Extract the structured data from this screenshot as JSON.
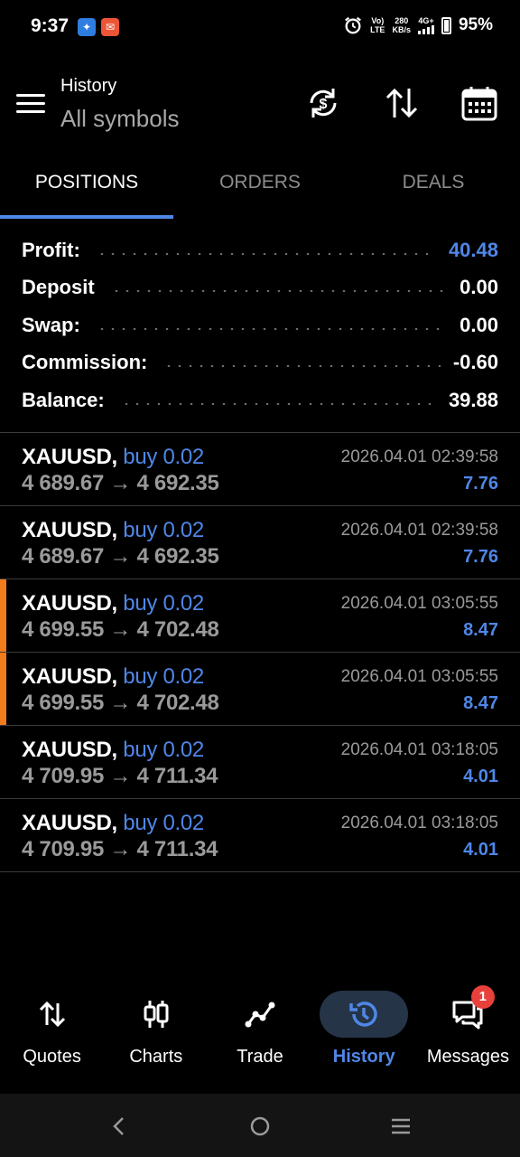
{
  "status_bar": {
    "time": "9:37",
    "network_top": "Vo)",
    "network_bottom": "LTE",
    "speed_value": "280",
    "speed_unit": "KB/s",
    "cell_label": "4G+",
    "battery": "95%"
  },
  "header": {
    "title": "History",
    "subtitle": "All symbols"
  },
  "tabs": [
    {
      "label": "POSITIONS",
      "active": true
    },
    {
      "label": "ORDERS",
      "active": false
    },
    {
      "label": "DEALS",
      "active": false
    }
  ],
  "summary": {
    "profit_label": "Profit:",
    "profit_value": "40.48",
    "deposit_label": "Deposit",
    "deposit_value": "0.00",
    "swap_label": "Swap:",
    "swap_value": "0.00",
    "commission_label": "Commission:",
    "commission_value": "-0.60",
    "balance_label": "Balance:",
    "balance_value": "39.88"
  },
  "positions": [
    {
      "symbol": "XAUUSD,",
      "side": "buy 0.02",
      "open_price": "4 689.67",
      "arrow": "→",
      "close_price": "4 692.35",
      "time": "2026.04.01 02:39:58",
      "profit": "7.76",
      "marked": false
    },
    {
      "symbol": "XAUUSD,",
      "side": "buy 0.02",
      "open_price": "4 689.67",
      "arrow": "→",
      "close_price": "4 692.35",
      "time": "2026.04.01 02:39:58",
      "profit": "7.76",
      "marked": false
    },
    {
      "symbol": "XAUUSD,",
      "side": "buy 0.02",
      "open_price": "4 699.55",
      "arrow": "→",
      "close_price": "4 702.48",
      "time": "2026.04.01 03:05:55",
      "profit": "8.47",
      "marked": true
    },
    {
      "symbol": "XAUUSD,",
      "side": "buy 0.02",
      "open_price": "4 699.55",
      "arrow": "→",
      "close_price": "4 702.48",
      "time": "2026.04.01 03:05:55",
      "profit": "8.47",
      "marked": true
    },
    {
      "symbol": "XAUUSD,",
      "side": "buy 0.02",
      "open_price": "4 709.95",
      "arrow": "→",
      "close_price": "4 711.34",
      "time": "2026.04.01 03:18:05",
      "profit": "4.01",
      "marked": false
    },
    {
      "symbol": "XAUUSD,",
      "side": "buy 0.02",
      "open_price": "4 709.95",
      "arrow": "→",
      "close_price": "4 711.34",
      "time": "2026.04.01 03:18:05",
      "profit": "4.01",
      "marked": false
    }
  ],
  "bottom_nav": [
    {
      "label": "Quotes",
      "icon": "quotes-icon",
      "active": false
    },
    {
      "label": "Charts",
      "icon": "charts-icon",
      "active": false
    },
    {
      "label": "Trade",
      "icon": "trade-icon",
      "active": false
    },
    {
      "label": "History",
      "icon": "history-icon",
      "active": true
    },
    {
      "label": "Messages",
      "icon": "messages-icon",
      "active": false,
      "badge": "1"
    }
  ],
  "colors": {
    "accent": "#4f87e8",
    "marker": "#f27b1b",
    "badge": "#e8403b",
    "muted": "#9a9a9a"
  }
}
